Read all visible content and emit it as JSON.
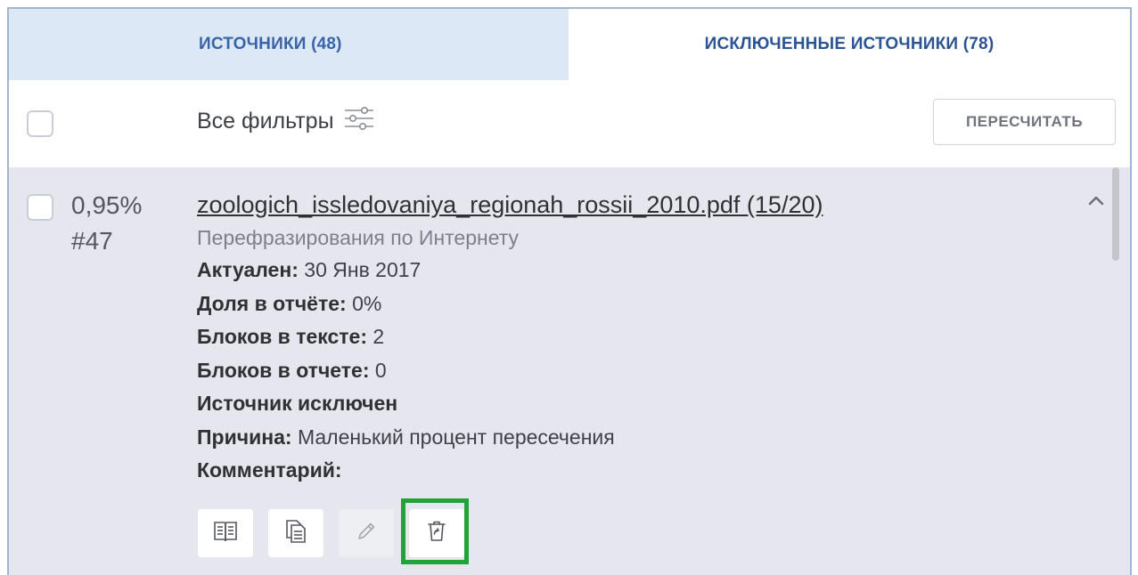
{
  "tabs": {
    "sources_label": "ИСТОЧНИКИ (48)",
    "excluded_label": "ИСКЛЮЧЕННЫЕ ИСТОЧНИКИ (78)"
  },
  "toolbar": {
    "filters_label": "Все фильтры",
    "filters_icon": "sliders-icon",
    "recalc_label": "ПЕРЕСЧИТАТЬ"
  },
  "source": {
    "percent": "0,95%",
    "number": "#47",
    "title": "zoologich_issledovaniya_regionah_rossii_2010.pdf (15/20)",
    "type": "Перефразирования по Интернету",
    "relevant_label": "Актуален:",
    "relevant_value": "30 Янв 2017",
    "share_label": "Доля в отчёте:",
    "share_value": "0%",
    "blocks_text_label": "Блоков в тексте:",
    "blocks_text_value": "2",
    "blocks_report_label": "Блоков в отчете:",
    "blocks_report_value": "0",
    "excluded_label": "Источник исключен",
    "reason_label": "Причина:",
    "reason_value": "Маленький процент пересечения",
    "comment_label": "Комментарий:"
  },
  "actions": [
    {
      "name": "open-book-icon"
    },
    {
      "name": "copy-document-icon"
    },
    {
      "name": "edit-pencil-icon"
    },
    {
      "name": "restore-trash-icon"
    }
  ],
  "colors": {
    "tab_inactive_bg": "#dde8f6",
    "tab_text": "#3a64a8",
    "item_bg": "#e6e7ee",
    "highlight": "#22a33a"
  }
}
